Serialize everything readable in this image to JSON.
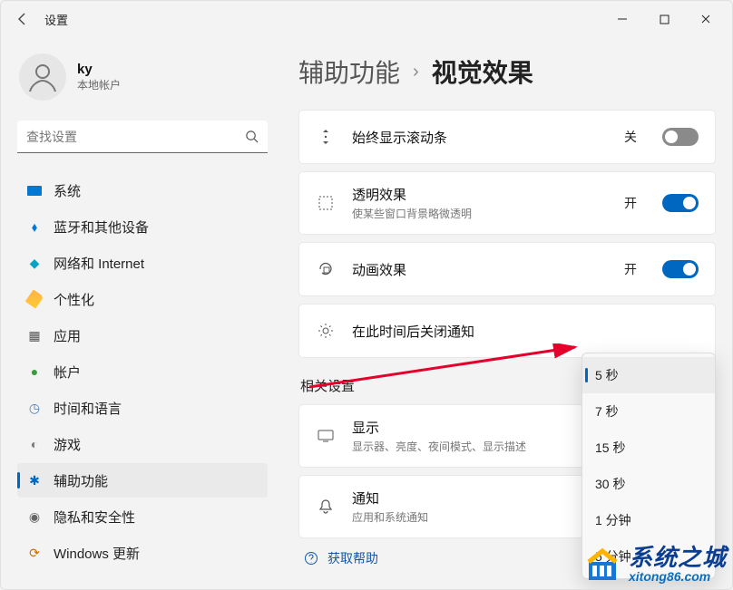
{
  "app": {
    "title": "设置"
  },
  "user": {
    "name": "ky",
    "sub": "本地帐户"
  },
  "search": {
    "placeholder": "查找设置"
  },
  "sidebar": {
    "items": [
      {
        "label": "系统"
      },
      {
        "label": "蓝牙和其他设备"
      },
      {
        "label": "网络和 Internet"
      },
      {
        "label": "个性化"
      },
      {
        "label": "应用"
      },
      {
        "label": "帐户"
      },
      {
        "label": "时间和语言"
      },
      {
        "label": "游戏"
      },
      {
        "label": "辅助功能"
      },
      {
        "label": "隐私和安全性"
      },
      {
        "label": "Windows 更新"
      }
    ]
  },
  "breadcrumb": {
    "parent": "辅助功能",
    "current": "视觉效果"
  },
  "settings": {
    "scrollbars": {
      "title": "始终显示滚动条",
      "state": "关"
    },
    "transparency": {
      "title": "透明效果",
      "sub": "使某些窗口背景略微透明",
      "state": "开"
    },
    "animation": {
      "title": "动画效果",
      "state": "开"
    },
    "notifyTimeout": {
      "title": "在此时间后关闭通知"
    }
  },
  "dropdown": {
    "options": [
      "5 秒",
      "7 秒",
      "15 秒",
      "30 秒",
      "1 分钟",
      "5 分钟"
    ],
    "selected": "5 秒"
  },
  "related": {
    "heading": "相关设置",
    "display": {
      "title": "显示",
      "sub": "显示器、亮度、夜间模式、显示描述"
    },
    "notifications": {
      "title": "通知",
      "sub": "应用和系统通知"
    }
  },
  "helpLink": "获取帮助",
  "watermark": {
    "name": "系统之城",
    "url": "xitong86.com"
  }
}
